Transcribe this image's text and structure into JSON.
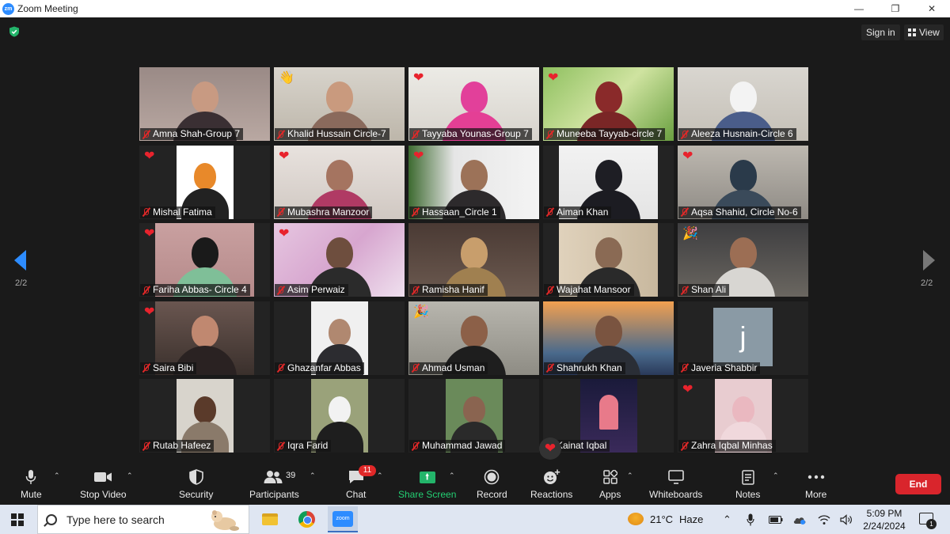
{
  "window": {
    "title": "Zoom Meeting",
    "app_logo": "zm"
  },
  "header": {
    "signin": "Sign in",
    "view": "View"
  },
  "pages": {
    "left": "2/2",
    "right": "2/2"
  },
  "participants": [
    {
      "name": "Amna Shah-Group 7",
      "reaction": ""
    },
    {
      "name": "Khalid Hussain Circle-7",
      "reaction": "👋"
    },
    {
      "name": "Tayyaba Younas-Group 7",
      "reaction": "❤"
    },
    {
      "name": "Muneeba Tayyab-circle 7",
      "reaction": "❤"
    },
    {
      "name": "Aleeza Husnain-Circle 6",
      "reaction": ""
    },
    {
      "name": "Mishal Fatima",
      "reaction": "❤"
    },
    {
      "name": "Mubashra Manzoor",
      "reaction": "❤"
    },
    {
      "name": "Hassaan_Circle 1",
      "reaction": "❤"
    },
    {
      "name": "Aiman Khan",
      "reaction": ""
    },
    {
      "name": "Aqsa Shahid, Circle No-6",
      "reaction": "❤"
    },
    {
      "name": "Fariha Abbas- Circle 4",
      "reaction": "❤"
    },
    {
      "name": "Asim Perwaiz",
      "reaction": "❤"
    },
    {
      "name": "Ramisha Hanif",
      "reaction": ""
    },
    {
      "name": "Wajahat Mansoor",
      "reaction": ""
    },
    {
      "name": "Shan Ali",
      "reaction": "🎉"
    },
    {
      "name": "Saira Bibi",
      "reaction": "❤"
    },
    {
      "name": "Ghazanfar Abbas",
      "reaction": ""
    },
    {
      "name": "Ahmad Usman",
      "reaction": "🎉"
    },
    {
      "name": "Shahrukh Khan",
      "reaction": ""
    },
    {
      "name": "Javeria Shabbir",
      "reaction": "",
      "avatar_letter": "j"
    },
    {
      "name": "Rutab Hafeez",
      "reaction": ""
    },
    {
      "name": "Iqra Farid",
      "reaction": ""
    },
    {
      "name": "Muhammad Jawad",
      "reaction": ""
    },
    {
      "name": "Kainat Iqbal",
      "reaction": ""
    },
    {
      "name": "Zahra Iqbal Minhas",
      "reaction": "❤"
    }
  ],
  "floating_reaction": "❤",
  "toolbar": {
    "mute": "Mute",
    "stop_video": "Stop Video",
    "security": "Security",
    "participants": "Participants",
    "participant_count": "39",
    "chat": "Chat",
    "chat_badge": "11",
    "share_screen": "Share Screen",
    "record": "Record",
    "reactions": "Reactions",
    "apps": "Apps",
    "whiteboards": "Whiteboards",
    "notes": "Notes",
    "more": "More",
    "end": "End"
  },
  "taskbar": {
    "search_placeholder": "Type here to search",
    "temperature": "21°C",
    "weather": "Haze",
    "time": "5:09 PM",
    "date": "2/24/2024",
    "notification_count": "1"
  },
  "colors": {
    "accent": "#2d8cff",
    "end": "#d9252c",
    "share": "#23d073",
    "heart": "#e8232d"
  }
}
